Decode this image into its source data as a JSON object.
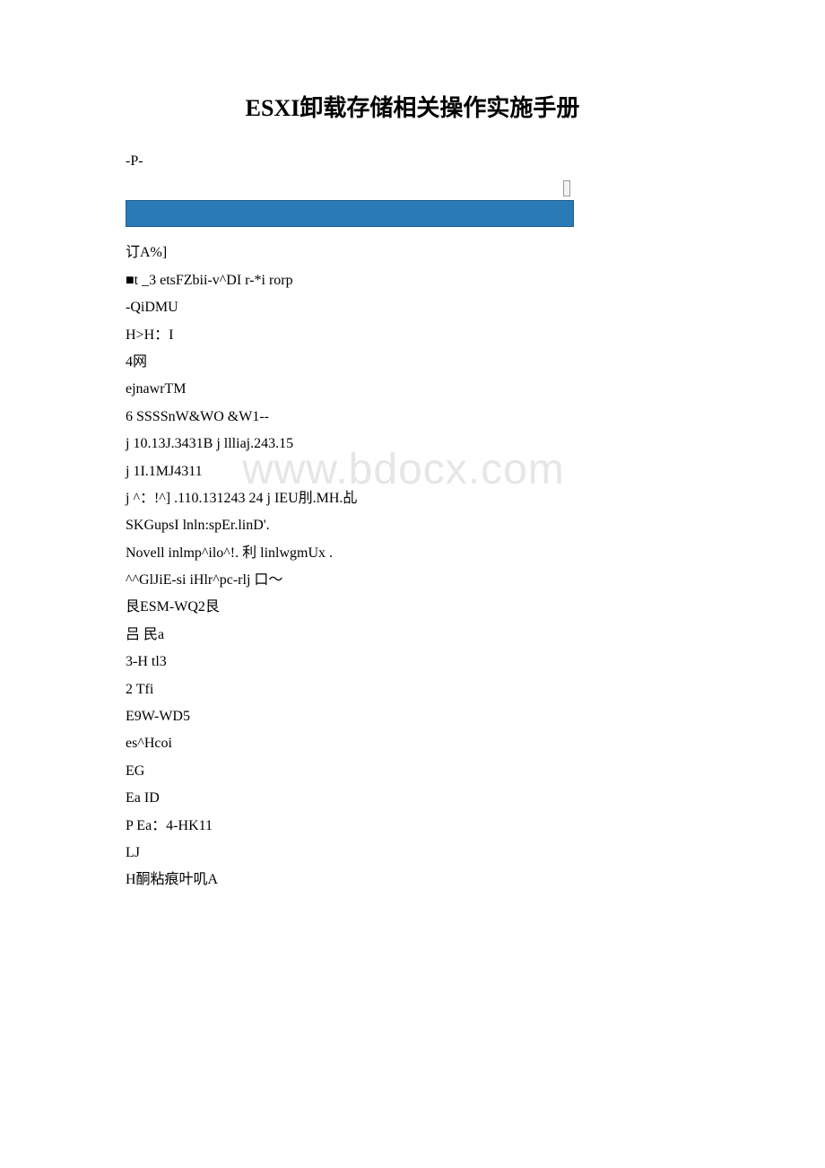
{
  "title": "ESXI卸载存储相关操作实施手册",
  "watermark": "www.bdocx.com",
  "lines": [
    "-P-",
    "订A%]",
    "■t _3 etsFZbii-v^DI r-*i rorp",
    "-QiDMU",
    "H>H：I",
    "4网",
    "ejnawrTM",
    "6 SSSSnW&WO &W1--",
    "j 10.13J.3431B j llliaj.243.15",
    "j 1I.1MJ4311",
    "j ^：!^] .110.131243 24 j IEU刖.MH.乩",
    "SKGupsI lnln:spEr.linD'.",
    "Novell inlmp^ilo^!. 利 linlwgmUx .",
    "^^GlJiE-si iHlr^pc-rlj 口～",
    "艮ESM-WQ2艮",
    "吕 民a",
    "3-H tl3",
    "2 Tfi",
    "E9W-WD5",
    "es^Hcoi",
    "EG",
    "Ea ID",
    "P Ea：4-HK11",
    "LJ",
    "H酮粘痕叶叽A"
  ]
}
